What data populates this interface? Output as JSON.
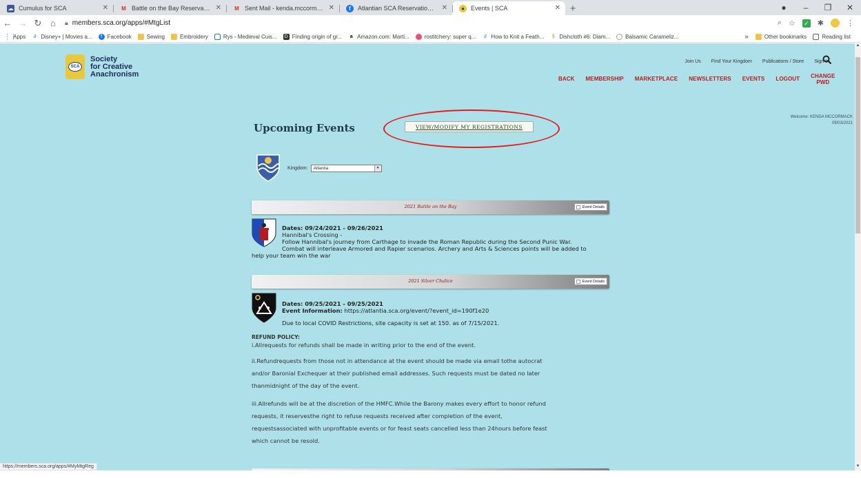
{
  "browser": {
    "tabs": [
      {
        "title": "Cumulus for SCA",
        "icon": "cumulus-icon",
        "active": false
      },
      {
        "title": "Battle on the Bay Reservation - ѕс",
        "icon": "gmail-icon",
        "active": false
      },
      {
        "title": "Sent Mail - kenda.mccormack@",
        "icon": "gmail-icon",
        "active": false
      },
      {
        "title": "Atlantian SCA Reservation System",
        "icon": "facebook-icon",
        "active": false
      },
      {
        "title": "Events | SCA",
        "icon": "sca-icon",
        "active": true
      }
    ],
    "new_tab": "+",
    "url": "members.sca.org/apps/#MtgList",
    "bookmarks": [
      {
        "label": "Apps",
        "icon": "apps-grid-icon"
      },
      {
        "label": "Disney+ | Movies a...",
        "icon": "link-icon"
      },
      {
        "label": "Facebook",
        "icon": "facebook-icon"
      },
      {
        "label": "Sewing",
        "icon": "folder-icon"
      },
      {
        "label": "Embroidery",
        "icon": "folder-icon"
      },
      {
        "label": "Rys - Medieval Cuis...",
        "icon": "doc-icon"
      },
      {
        "label": "Finding origin of gr...",
        "icon": "dc-icon"
      },
      {
        "label": "Amazon.com: Marti...",
        "icon": "amazon-icon"
      },
      {
        "label": "rostitchery: super q...",
        "icon": "globe-icon"
      },
      {
        "label": "How to Knit a Feath...",
        "icon": "link-icon"
      },
      {
        "label": "Dishcloth #6: Diam...",
        "icon": "pattern-icon"
      },
      {
        "label": "Balsamic Carameliz...",
        "icon": "globe-icon"
      }
    ],
    "bookmarks_overflow": "»",
    "other_bookmarks": "Other bookmarks",
    "reading_list": "Reading list",
    "status_url": "https://members.sca.org/apps/#MyMtgReg"
  },
  "site": {
    "logo_lines": [
      "Society",
      "for Creative",
      "Anachronism"
    ],
    "logo_badge": "SCA",
    "top_links": [
      "Join Us",
      "Find Your Kingdom",
      "Publications / Store",
      "Sign In"
    ],
    "nav": [
      "BACK",
      "MEMBERSHIP",
      "MARKETPLACE",
      "NEWSLETTERS",
      "EVENTS",
      "LOGOUT"
    ],
    "nav_last": [
      "CHANGE",
      "PWD"
    ],
    "welcome": "Welcome: KENDA MCCORMACK",
    "date": "09/03/2021"
  },
  "events_page": {
    "title": "Upcoming Events",
    "view_modify_button": "VIEW/MODIFY MY REGISTRATIONS",
    "kingdom_label": "Kingdom:",
    "kingdom_value": "Atlantia",
    "details_button": "Event Details",
    "events": [
      {
        "title": "2021 Battle on the Bay",
        "dates": "Dates: 09/24/2021 - 09/26/2021",
        "lines": [
          "Hannibal's Crossing -",
          "Follow Hannibal's journey from Carthage to invade the Roman Republic during the Second Punic War.",
          "Combat will interleave Armored and Rapier scenarios. Archery and Arts & Sciences points will be added to",
          "help your team win the war"
        ]
      },
      {
        "title": "2021 Silver Chalice",
        "dates": "Dates: 09/25/2021 - 09/25/2021",
        "info_label": "Event Information:",
        "info_value": "https://atlantia.sca.org/event/?event_id=190f1e20",
        "note": "Due to local COVID Restrictions, site capacity is set at 150. as of 7/15/2021."
      }
    ],
    "refund_heading": "REFUND POLICY:",
    "refund_paragraphs": [
      [
        "i.Allrequests for refunds shall be made in writing prior to the end of the event."
      ],
      [
        "ii.Refundrequests from those not in attendance at the event should be made via email tothe autocrat",
        "and/or Baronial Exchequer at their published email addresses. Such requests must be dated no later",
        "thanmidnight of the day of the event."
      ],
      [
        "iii.Allrefunds will be at the discretion of the HMFC.While the Barony makes every effort to honor refund",
        "requests, it reservesthe right to refuse requests received after completion of the event,",
        "requestsassociated with unprofitable events or for feast seats cancelled less than 24hours before feast",
        "which cannot be resold."
      ]
    ]
  },
  "colors": {
    "page_background": "#aee0ea",
    "nav_red": "#b71c1c",
    "annotation_ellipse": "#e31c1c",
    "active_tab": "#ffffff"
  }
}
